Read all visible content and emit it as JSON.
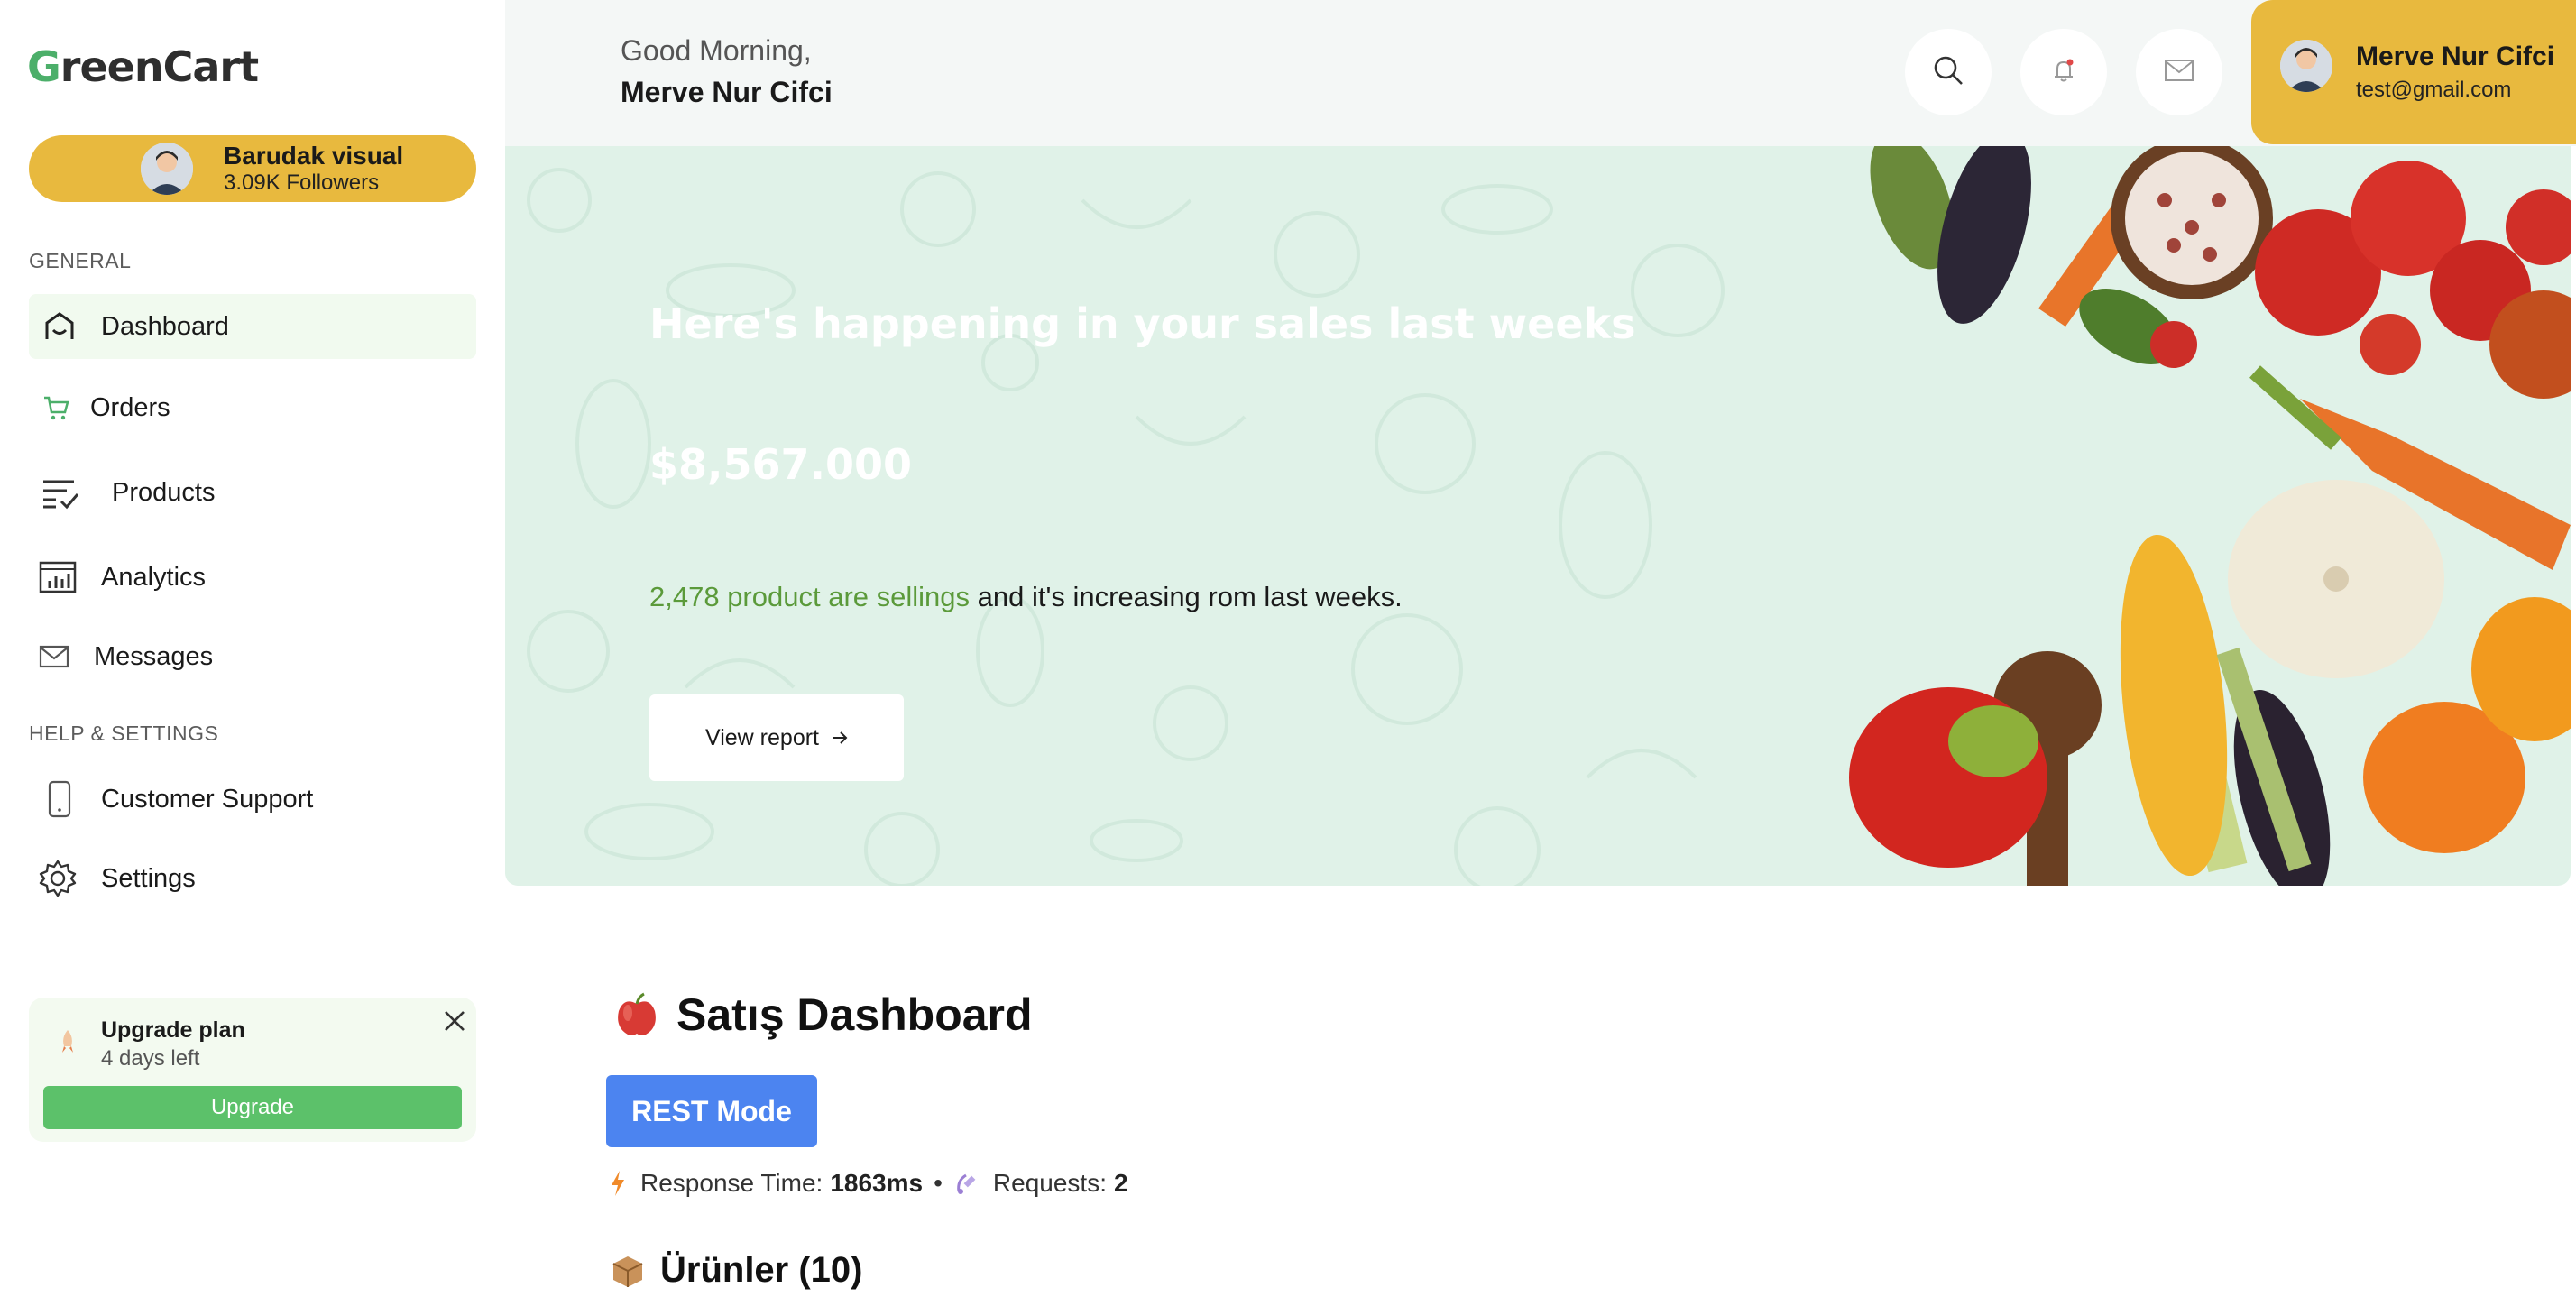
{
  "brand": {
    "name_first_letter": "G",
    "name_rest": "reenCart"
  },
  "sidebar_profile": {
    "name": "Barudak visual",
    "followers": "3.09K Followers"
  },
  "sidebar": {
    "general_label": "GENERAL",
    "help_label": "HELP & SETTINGS",
    "items": [
      {
        "label": "Dashboard",
        "icon": "home-icon"
      },
      {
        "label": "Orders",
        "icon": "cart-icon"
      },
      {
        "label": "Products",
        "icon": "list-check-icon"
      },
      {
        "label": "Analytics",
        "icon": "analytics-icon"
      },
      {
        "label": "Messages",
        "icon": "mail-icon"
      },
      {
        "label": "Customer Support",
        "icon": "phone-icon"
      },
      {
        "label": "Settings",
        "icon": "gear-icon"
      }
    ]
  },
  "upgrade": {
    "title": "Upgrade plan",
    "subtitle": "4 days left",
    "button": "Upgrade"
  },
  "header": {
    "greeting": "Good Morning,",
    "name": "Merve Nur Cifci"
  },
  "user": {
    "name": "Merve Nur Cifci",
    "email": "test@gmail.com"
  },
  "hero": {
    "title": "Here's happening in your sales last weeks",
    "amount": "$8,567.000",
    "highlight": "2,478 product are sellings",
    "rest": " and it's increasing rom last weeks.",
    "button": "View report"
  },
  "dashboard": {
    "title": "Satış Dashboard",
    "mode_button": "REST Mode",
    "response_label": "Response Time:",
    "response_value": "1863ms",
    "separator": "•",
    "requests_label": "Requests:",
    "requests_value": "2",
    "products_title": "Ürünler (10)"
  },
  "colors": {
    "accent_yellow": "#e8b93e",
    "accent_green": "#5cc16a",
    "rest_blue": "#4c84f0",
    "hero_bg": "#e0f2e8"
  }
}
